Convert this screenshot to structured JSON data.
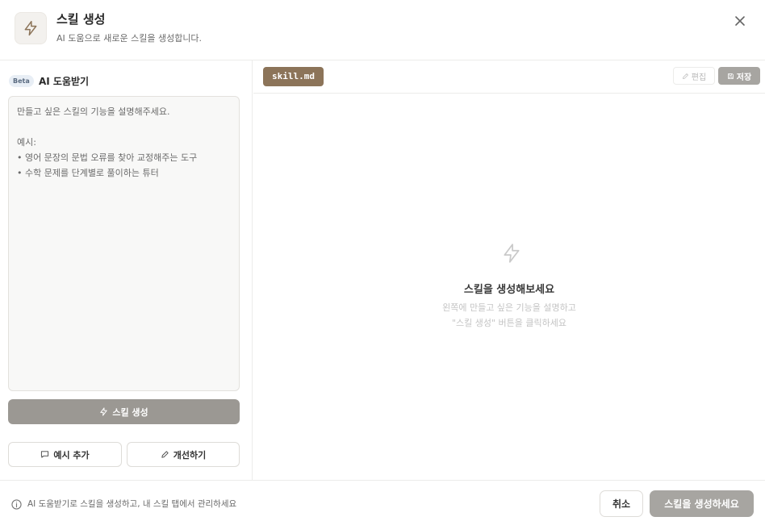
{
  "header": {
    "icon": "bolt-icon",
    "title": "스킬 생성",
    "subtitle": "AI 도움으로 새로운 스킬을 생성합니다.",
    "close_icon": "close-icon"
  },
  "left": {
    "badge": "Beta",
    "section_label": "AI 도움받기",
    "prompt_placeholder_lines": [
      "만들고 싶은 스킬의 기능을 설명해주세요.",
      "",
      "예시:",
      "• 영어 문장의 문법 오류를 찾아 교정해주는 도구",
      "• 수학 문제를 단계별로 풀이하는 튜터"
    ],
    "generate_label": "스킬 생성",
    "add_example_label": "예시 추가",
    "improve_label": "개선하기"
  },
  "right": {
    "file_tab": "skill.md",
    "edit_label": "편집",
    "save_label": "저장",
    "empty_title": "스킬을 생성해보세요",
    "empty_desc_1": "왼쪽에 만들고 싶은 기능을 설명하고",
    "empty_desc_2": "\"스킬 생성\" 버튼을 클릭하세요"
  },
  "footer": {
    "info_text": "AI 도움받기로 스킬을 생성하고, 내 스킬 탭에서 관리하세요",
    "cancel_label": "취소",
    "create_label": "스킬을 생성하세요"
  },
  "colors": {
    "accent": "#8c7459",
    "disabled_button": "#9b9893",
    "border": "#ececea"
  }
}
